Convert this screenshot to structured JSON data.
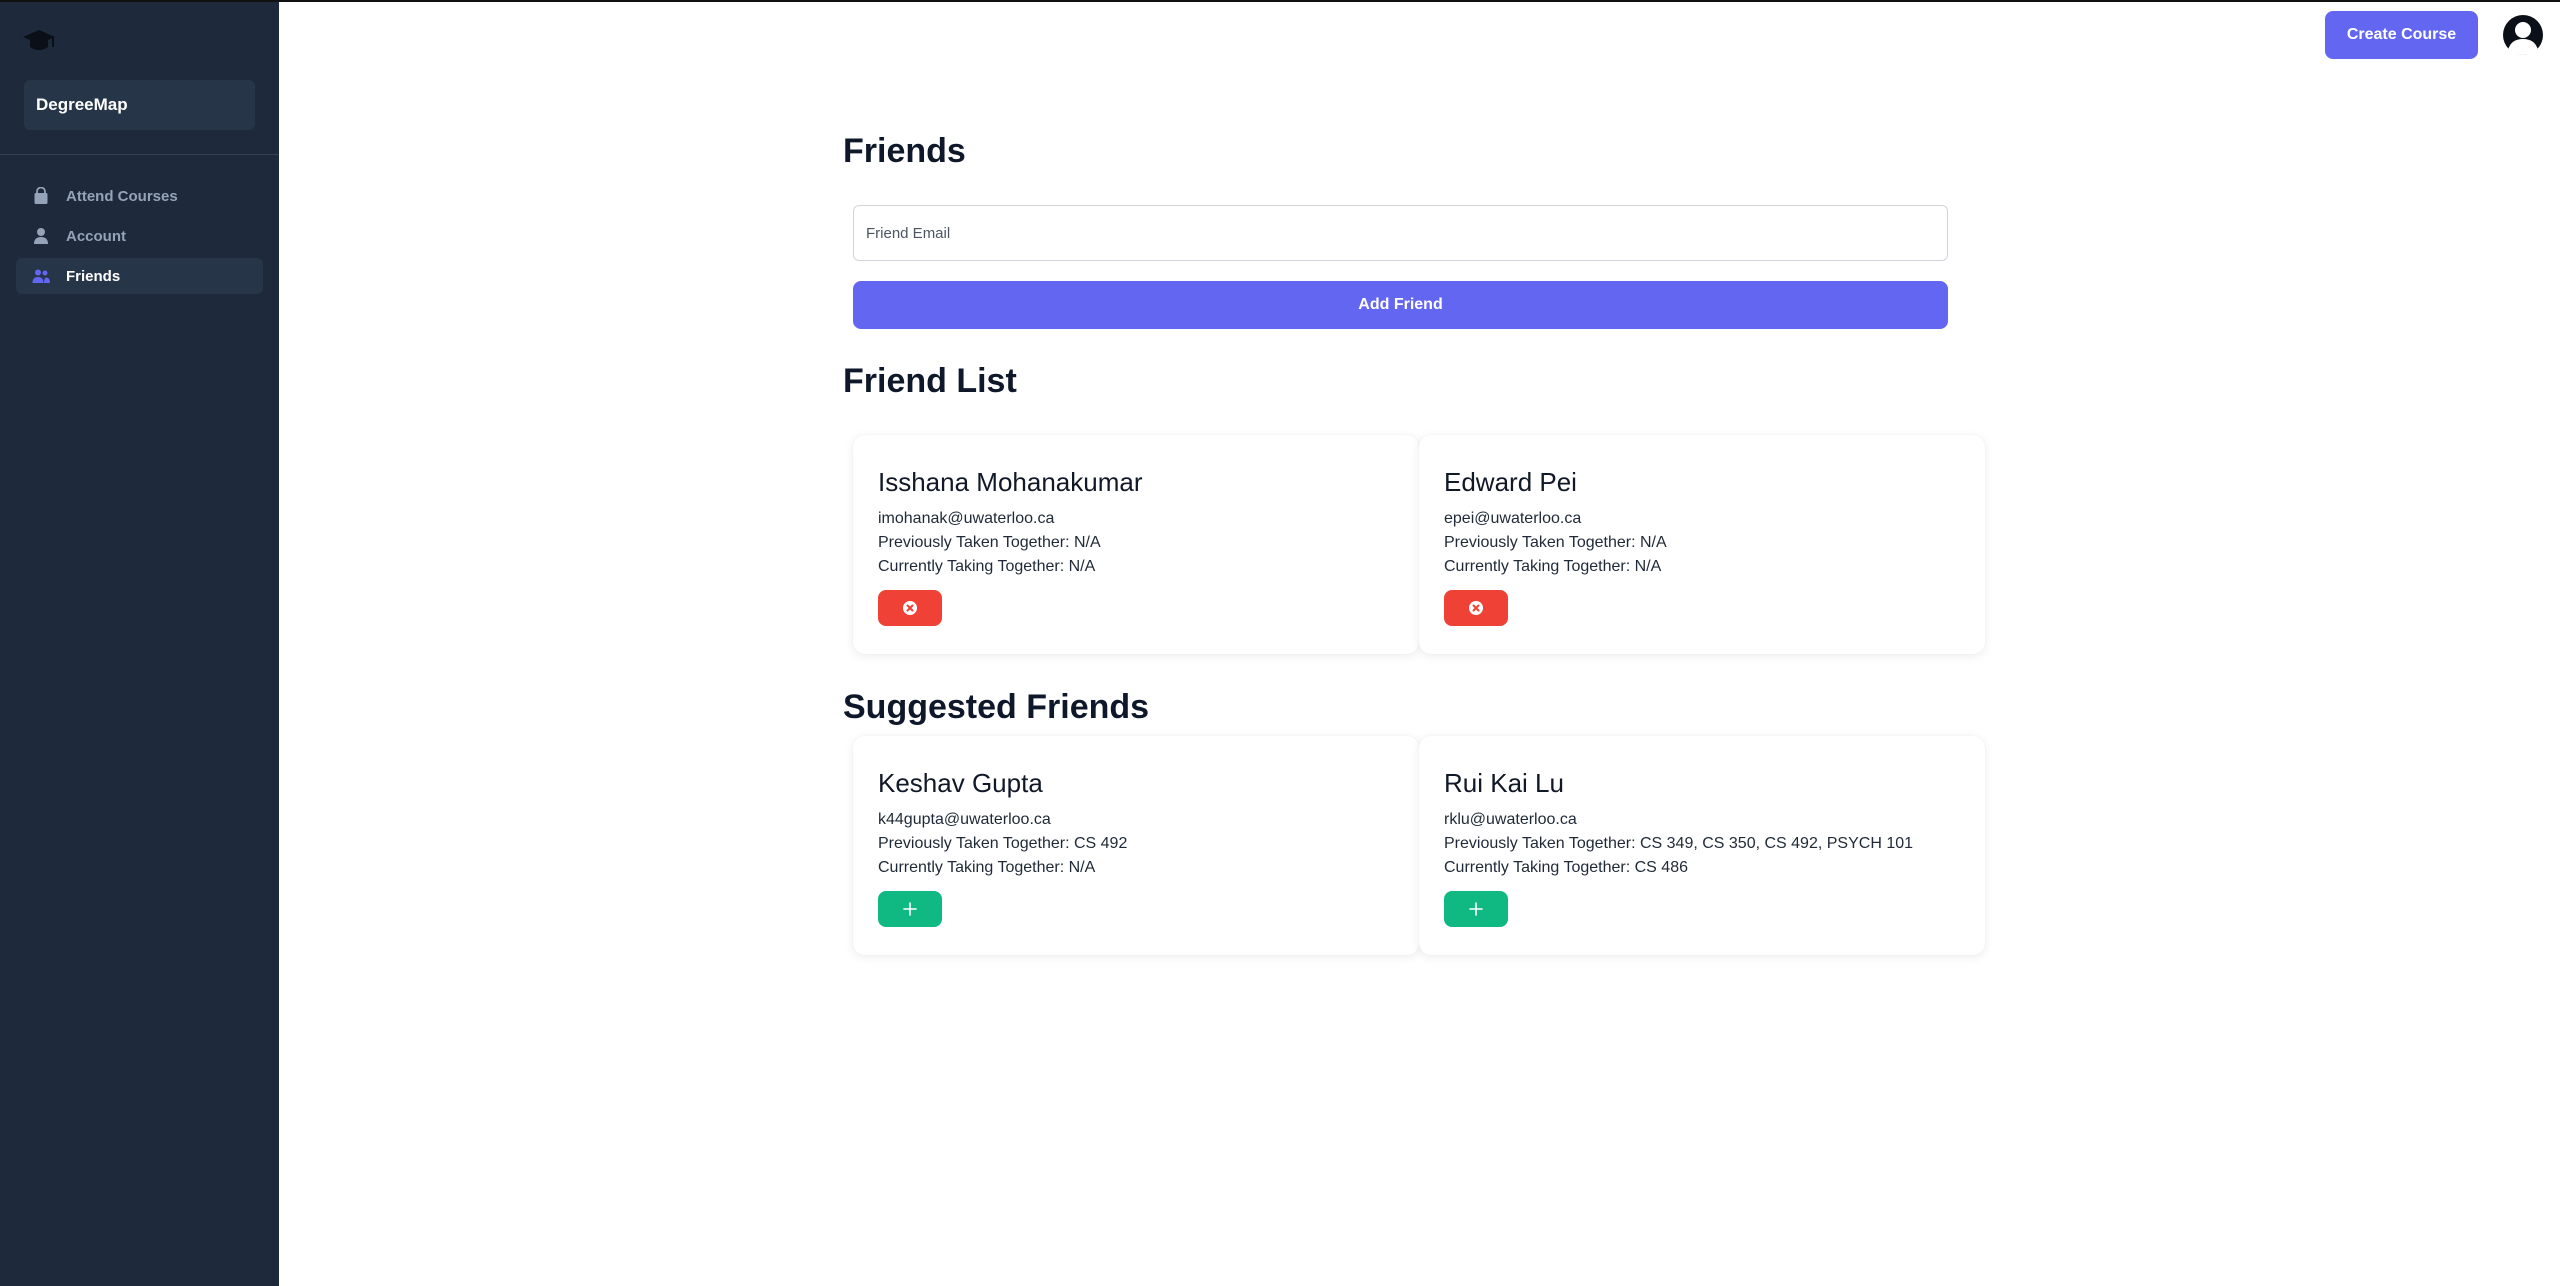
{
  "sidebar": {
    "brand": "DegreeMap",
    "logo_icon": "graduation-cap-icon",
    "items": [
      {
        "label": "Attend Courses",
        "icon": "bag-icon",
        "active": false
      },
      {
        "label": "Account",
        "icon": "user-icon",
        "active": false
      },
      {
        "label": "Friends",
        "icon": "users-icon",
        "active": true
      }
    ]
  },
  "header": {
    "create_course_label": "Create Course",
    "avatar_icon": "user-avatar-icon"
  },
  "main": {
    "title": "Friends",
    "email_placeholder": "Friend Email",
    "email_value": "",
    "add_button_label": "Add Friend",
    "friend_list_title": "Friend List",
    "suggested_title": "Suggested Friends",
    "friends": [
      {
        "name": "Isshana Mohanakumar",
        "email": "imohanak@uwaterloo.ca",
        "previously": "Previously Taken Together: N/A",
        "currently": "Currently Taking Together: N/A",
        "action_icon": "remove-circle-icon"
      },
      {
        "name": "Edward Pei",
        "email": "epei@uwaterloo.ca",
        "previously": "Previously Taken Together: N/A",
        "currently": "Currently Taking Together: N/A",
        "action_icon": "remove-circle-icon"
      }
    ],
    "suggested": [
      {
        "name": "Keshav Gupta",
        "email": "k44gupta@uwaterloo.ca",
        "previously": "Previously Taken Together: CS 492",
        "currently": "Currently Taking Together: N/A",
        "action_icon": "plus-icon"
      },
      {
        "name": "Rui Kai Lu",
        "email": "rklu@uwaterloo.ca",
        "previously": "Previously Taken Together: CS 349, CS 350, CS 492, PSYCH 101",
        "currently": "Currently Taking Together: CS 486",
        "action_icon": "plus-icon"
      }
    ]
  },
  "colors": {
    "sidebar_bg": "#1e293b",
    "accent": "#6366f1",
    "danger": "#ef4135",
    "success": "#10b981"
  }
}
